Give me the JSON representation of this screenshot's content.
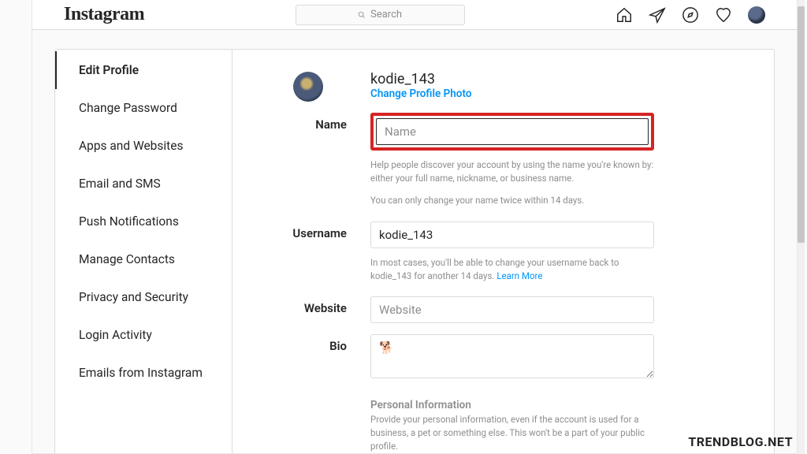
{
  "brand": "Instagram",
  "search": {
    "placeholder": "Search"
  },
  "sidebar": {
    "items": [
      {
        "label": "Edit Profile"
      },
      {
        "label": "Change Password"
      },
      {
        "label": "Apps and Websites"
      },
      {
        "label": "Email and SMS"
      },
      {
        "label": "Push Notifications"
      },
      {
        "label": "Manage Contacts"
      },
      {
        "label": "Privacy and Security"
      },
      {
        "label": "Login Activity"
      },
      {
        "label": "Emails from Instagram"
      }
    ],
    "activeIndex": 0
  },
  "profile": {
    "username_display": "kodie_143",
    "change_photo_label": "Change Profile Photo"
  },
  "fields": {
    "name": {
      "label": "Name",
      "placeholder": "Name",
      "value": "",
      "help1": "Help people discover your account by using the name you're known by: either your full name, nickname, or business name.",
      "help2": "You can only change your name twice within 14 days."
    },
    "username": {
      "label": "Username",
      "value": "kodie_143",
      "help_prefix": "In most cases, you'll be able to change your username back to kodie_143 for another 14 days. ",
      "learn_more": "Learn More"
    },
    "website": {
      "label": "Website",
      "placeholder": "Website",
      "value": ""
    },
    "bio": {
      "label": "Bio",
      "value": "🐕"
    },
    "personal": {
      "title": "Personal Information",
      "desc": "Provide your personal information, even if the account is used for a business, a pet or something else. This won't be a part of your public profile."
    }
  },
  "watermark": "TRENDBLOG.NET"
}
